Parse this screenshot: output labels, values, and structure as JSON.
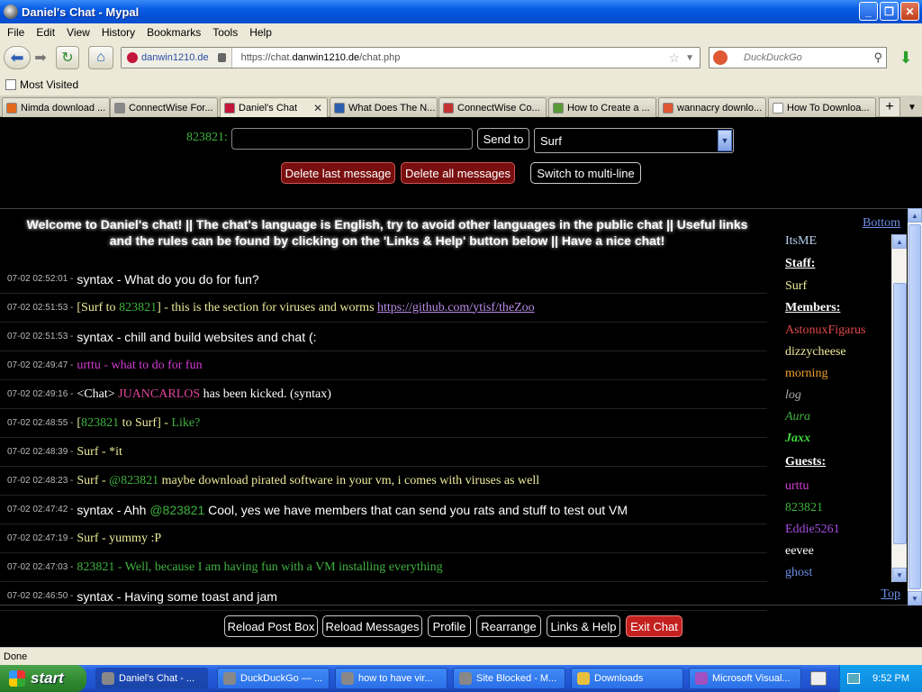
{
  "window": {
    "title": "Daniel's Chat - Mypal",
    "min_label": "_",
    "max_label": "❐",
    "close_label": "✕"
  },
  "menu": [
    "File",
    "Edit",
    "View",
    "History",
    "Bookmarks",
    "Tools",
    "Help"
  ],
  "nav": {
    "site_identity": "danwin1210.de",
    "url_prefix": "https://chat.",
    "url_domain": "danwin1210.de",
    "url_path": "/chat.php",
    "search_placeholder": "DuckDuckGo"
  },
  "bookmarks": {
    "most_visited": "Most Visited"
  },
  "tabs": [
    {
      "label": "Nimda download ...",
      "color": "#e36a1c"
    },
    {
      "label": "ConnectWise For...",
      "color": "#888888"
    },
    {
      "label": "Daniel's Chat",
      "color": "#c3163a",
      "active": true
    },
    {
      "label": "What Does The N...",
      "color": "#2a5fb0"
    },
    {
      "label": "ConnectWise Co...",
      "color": "#c33333"
    },
    {
      "label": "How to Create a ...",
      "color": "#5a9a3a"
    },
    {
      "label": "wannacry downlo...",
      "color": "#de5833"
    },
    {
      "label": "How To Downloa...",
      "color": "#ffffff"
    }
  ],
  "chat_form": {
    "user_label": "823821",
    "user_colon": ":",
    "send_label": "Send to",
    "recipient_selected": "Surf",
    "delete_last": "Delete last message",
    "delete_all": "Delete all messages",
    "switch_multiline": "Switch to multi-line"
  },
  "welcome": "Welcome to Daniel's chat! || The chat's language is English, try to avoid other languages in the public chat || Useful links and the rules can be found by clicking on the 'Links & Help' button below || Have a nice chat!",
  "messages": [
    {
      "time": "07-02 02:52:01 -",
      "parts": [
        {
          "t": "syntax - What do you do for fun?",
          "c": "c-white",
          "sans": true
        }
      ]
    },
    {
      "time": "07-02 02:51:53 -",
      "parts": [
        {
          "t": "[Surf to ",
          "c": "c-yellow"
        },
        {
          "t": "823821",
          "c": "c-green"
        },
        {
          "t": "] - this is the section for viruses and worms ",
          "c": "c-yellow"
        },
        {
          "t": "https://github.com/ytisf/theZoo",
          "c": "c-link"
        }
      ]
    },
    {
      "time": "07-02 02:51:53 -",
      "parts": [
        {
          "t": "syntax - chill and build websites and chat (:",
          "c": "c-white",
          "sans": true
        }
      ]
    },
    {
      "time": "07-02 02:49:47 -",
      "parts": [
        {
          "t": "urttu - what to do for fun",
          "c": "c-magenta"
        }
      ]
    },
    {
      "time": "07-02 02:49:16 -",
      "parts": [
        {
          "t": "<Chat> ",
          "c": "c-white"
        },
        {
          "t": "JUANCARLOS",
          "c": "c-pink"
        },
        {
          "t": " has been kicked. (syntax)",
          "c": "c-white"
        }
      ]
    },
    {
      "time": "07-02 02:48:55 -",
      "parts": [
        {
          "t": "[",
          "c": "c-yellow"
        },
        {
          "t": "823821",
          "c": "c-green"
        },
        {
          "t": " to Surf] - ",
          "c": "c-yellow"
        },
        {
          "t": "Like?",
          "c": "c-green"
        }
      ]
    },
    {
      "time": "07-02 02:48:39 -",
      "parts": [
        {
          "t": "Surf - *it",
          "c": "c-yellow"
        }
      ]
    },
    {
      "time": "07-02 02:48:23 -",
      "parts": [
        {
          "t": "Surf - ",
          "c": "c-yellow"
        },
        {
          "t": "@823821",
          "c": "c-green"
        },
        {
          "t": " maybe download pirated software in your vm, i comes with viruses as well",
          "c": "c-yellow"
        }
      ]
    },
    {
      "time": "07-02 02:47:42 -",
      "parts": [
        {
          "t": "syntax - Ahh ",
          "c": "c-white",
          "sans": true
        },
        {
          "t": "@823821",
          "c": "c-green",
          "sans": true
        },
        {
          "t": " Cool, yes we have members that can send you rats and stuff to test out VM",
          "c": "c-white",
          "sans": true
        }
      ]
    },
    {
      "time": "07-02 02:47:19 -",
      "parts": [
        {
          "t": "Surf - yummy :P",
          "c": "c-yellow"
        }
      ]
    },
    {
      "time": "07-02 02:47:03 -",
      "parts": [
        {
          "t": "823821 - Well, because I am having fun with a VM installing everything",
          "c": "c-green"
        }
      ]
    },
    {
      "time": "07-02 02:46:50 -",
      "parts": [
        {
          "t": "syntax - Having some toast and jam",
          "c": "c-white",
          "sans": true
        }
      ]
    }
  ],
  "online": {
    "bottom_link": "Bottom",
    "top_link": "Top",
    "first": "ItsME",
    "staff_head": "Staff:",
    "staff": [
      "Surf"
    ],
    "members_head": "Members:",
    "members": [
      {
        "name": "AstonuxFigarus",
        "color": "#e04848"
      },
      {
        "name": "dizzycheese",
        "color": "#ecec9a"
      },
      {
        "name": "morning",
        "color": "#f0a030"
      },
      {
        "name": "log",
        "color": "#aaaaaa"
      },
      {
        "name": "Aura",
        "color": "#3fb23f"
      },
      {
        "name": "Jaxx",
        "color": "#3fd83f"
      }
    ],
    "guests_head": "Guests:",
    "guests": [
      {
        "name": "urttu",
        "color": "#d23ed2"
      },
      {
        "name": "823821",
        "color": "#3fb23f"
      },
      {
        "name": "Eddie5261",
        "color": "#a64ee0"
      },
      {
        "name": "eevee",
        "color": "#ffffff"
      },
      {
        "name": "ghost",
        "color": "#6b8fe6"
      }
    ]
  },
  "bottom_buttons": [
    "Reload Post Box",
    "Reload Messages",
    "Profile",
    "Rearrange",
    "Links & Help",
    "Exit Chat"
  ],
  "status": "Done",
  "taskbar": {
    "start": "start",
    "tasks": [
      {
        "label": "Daniel's Chat - ...",
        "color": "#888888",
        "active": true
      },
      {
        "label": "DuckDuckGo — ...",
        "color": "#888888"
      },
      {
        "label": "how to have vir...",
        "color": "#888888"
      },
      {
        "label": "Site Blocked - M...",
        "color": "#888888"
      },
      {
        "label": "Downloads",
        "color": "#e8c040"
      },
      {
        "label": "Microsoft Visual...",
        "color": "#a050c0"
      }
    ],
    "clock": "9:52 PM"
  }
}
